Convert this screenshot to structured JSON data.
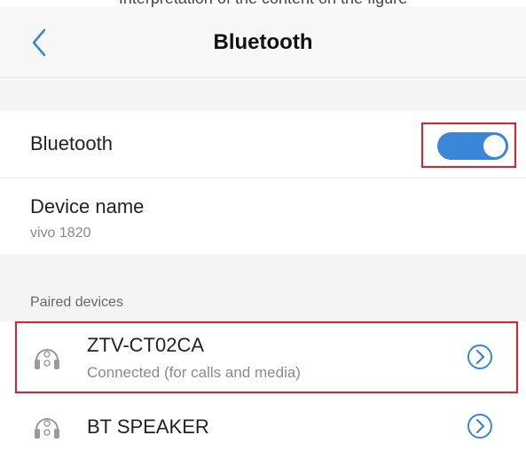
{
  "top_cut_text": "Interpretation of the content on the figure",
  "header": {
    "title": "Bluetooth"
  },
  "bluetooth_row": {
    "label": "Bluetooth",
    "toggle_on": true
  },
  "device_name_row": {
    "label": "Device name",
    "value": "vivo 1820"
  },
  "paired_section": {
    "label": "Paired devices",
    "devices": [
      {
        "name": "ZTV-CT02CA",
        "status": "Connected (for calls and media)",
        "icon": "headset-icon"
      },
      {
        "name": "BT SPEAKER",
        "status": "",
        "icon": "headset-icon"
      }
    ]
  },
  "colors": {
    "accent": "#3a86d8",
    "highlight_box": "#e0202a"
  }
}
